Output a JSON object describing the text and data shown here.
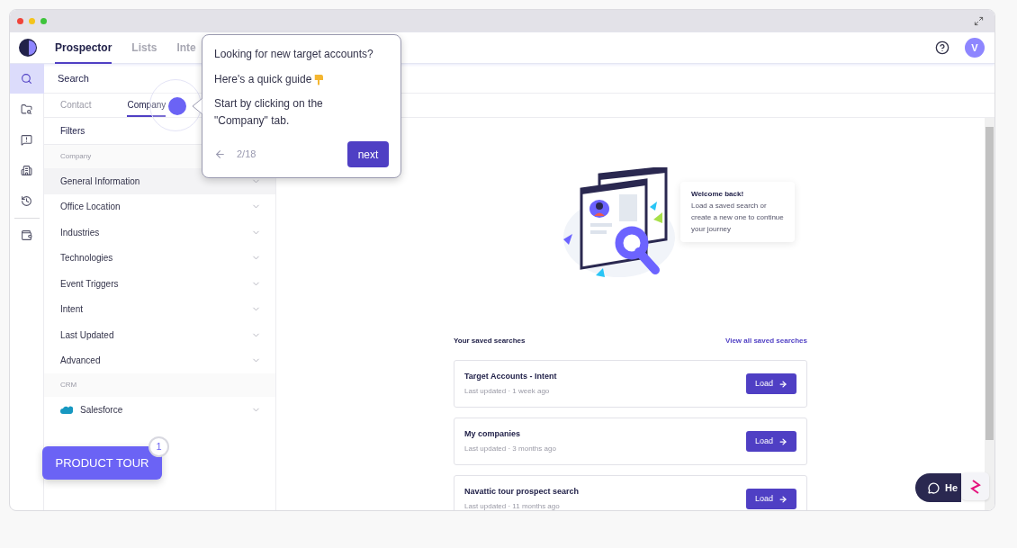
{
  "header": {
    "tabs": [
      {
        "label": "Prospector",
        "selected": true
      },
      {
        "label": "Lists",
        "selected": false
      },
      {
        "label": "Inte",
        "selected": false
      }
    ],
    "avatar": "V"
  },
  "rail": [
    {
      "selected": true
    },
    {
      "selected": false
    },
    {
      "selected": false
    },
    {
      "selected": false
    },
    {
      "selected": false
    },
    {
      "selected": false
    }
  ],
  "sidebar": {
    "search_label": "Search",
    "tabs": [
      {
        "label": "Contact",
        "selected": false
      },
      {
        "label": "Company",
        "selected": true
      }
    ],
    "filters_label": "Filters",
    "sections": [
      {
        "title": "Company",
        "items": [
          {
            "label": "General Information",
            "kind": "filter",
            "selected": true
          },
          {
            "label": "Office Location",
            "kind": "filter",
            "selected": false
          },
          {
            "label": "Industries",
            "kind": "filter",
            "selected": false
          },
          {
            "label": "Technologies",
            "kind": "filter",
            "selected": false
          },
          {
            "label": "Event Triggers",
            "kind": "filter",
            "selected": false
          },
          {
            "label": "Intent",
            "kind": "filter",
            "selected": false
          },
          {
            "label": "Last Updated",
            "kind": "filter",
            "selected": false
          },
          {
            "label": "Advanced",
            "kind": "filter",
            "selected": false
          }
        ]
      },
      {
        "title": "CRM",
        "items": [
          {
            "label": "Salesforce",
            "kind": "crm",
            "selected": false
          }
        ]
      }
    ]
  },
  "tour": {
    "lines": [
      "Looking for new target accounts?",
      "Here's a quick guide",
      "Start by clicking on the \"Company\" tab."
    ],
    "counter": "2/18",
    "next": "next"
  },
  "product_tour": {
    "label": "PRODUCT TOUR",
    "badge": "1"
  },
  "welcome": {
    "title": "Welcome back!",
    "text": "Load a saved search or create a new one to continue your journey"
  },
  "saved_searches": {
    "title": "Your saved searches",
    "link": "View all saved searches",
    "items": [
      {
        "name": "Target Accounts - Intent",
        "updated": "Last updated · 1 week ago",
        "button": "Load"
      },
      {
        "name": "My companies",
        "updated": "Last updated · 3 months ago",
        "button": "Load"
      },
      {
        "name": "Navattic tour prospect search",
        "updated": "Last updated · 11 months ago",
        "button": "Load"
      }
    ]
  },
  "help": {
    "label": "He"
  }
}
